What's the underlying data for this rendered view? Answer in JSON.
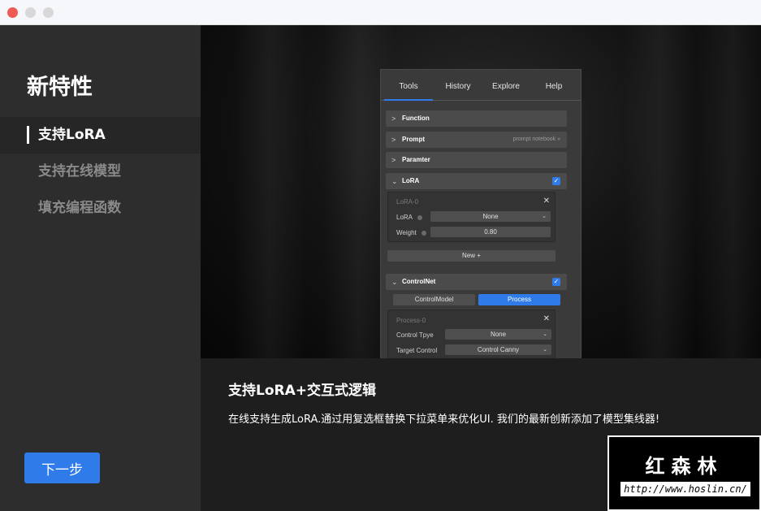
{
  "sidebar": {
    "title": "新特性",
    "items": [
      {
        "label": "支持LoRA",
        "active": true
      },
      {
        "label": "支持在线模型",
        "active": false
      },
      {
        "label": "填充编程函数",
        "active": false
      }
    ],
    "next_label": "下一步"
  },
  "preview": {
    "tabs": [
      "Tools",
      "History",
      "Explore",
      "Help"
    ],
    "sections": {
      "function": "Function",
      "prompt": "Prompt",
      "prompt_hint": "prompt notebook »",
      "paramter": "Paramter",
      "lora": "LoRA",
      "controlnet": "ControlNet"
    },
    "lora_box": {
      "title": "LoRA-0",
      "lora_label": "LoRA",
      "lora_value": "None",
      "weight_label": "Weight",
      "weight_value": "0.80",
      "new_label": "New +"
    },
    "controlnet": {
      "seg_model": "ControlModel",
      "seg_process": "Process",
      "box_title": "Process-0",
      "type_label": "Control Tpye",
      "type_value": "None",
      "target_label": "Target Control",
      "target_value": "Control Canny"
    }
  },
  "description": {
    "title": "支持LoRA+交互式逻辑",
    "text": "在线支持生成LoRA.通过用复选框替换下拉菜单来优化UI. 我们的最新创新添加了模型集线器!"
  },
  "watermark": {
    "name": "红森林",
    "url": "http://www.hoslin.cn/"
  },
  "colors": {
    "accent": "#2f7bea",
    "sidebar_bg": "#2d2d2d",
    "content_bg": "#1e1e1e"
  }
}
